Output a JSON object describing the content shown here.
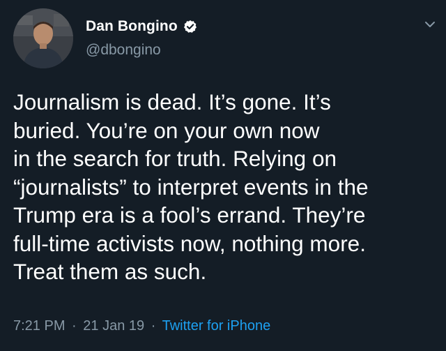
{
  "tweet": {
    "display_name": "Dan Bongino",
    "handle": "@dbongino",
    "lines": [
      "Journalism is dead. It’s gone. It’s",
      "buried. You’re on your own now",
      "in the search for truth. Relying on",
      "“journalists” to interpret events in the",
      "Trump era is a fool’s errand. They’re",
      "full-time activists now, nothing more.",
      "Treat them as such."
    ],
    "time": "7:21 PM",
    "separator": "·",
    "date": "21 Jan 19",
    "source": "Twitter for iPhone",
    "verified": true,
    "avatar_icon": "profile-photo",
    "verified_icon": "verified-badge-icon",
    "menu_icon": "chevron-down-icon"
  },
  "colors": {
    "background": "#141d26",
    "text": "#ffffff",
    "secondary": "#8899a6",
    "link": "#1da1f2"
  }
}
